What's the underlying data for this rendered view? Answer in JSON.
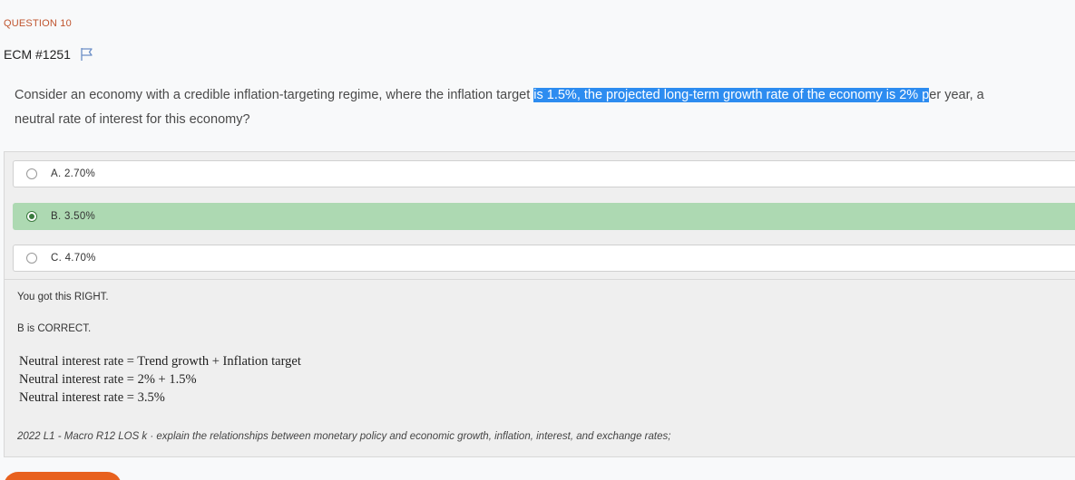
{
  "question": {
    "label": "QUESTION 10",
    "id": "ECM #1251",
    "stem_line1_pre": "Consider an economy with a credible inflation-targeting regime, where the inflation target ",
    "stem_line1_highlight": "is 1.5%, the projected long-term growth rate of the economy is 2% p",
    "stem_line1_post": "er year, a",
    "stem_line2": "neutral rate of interest for this economy?"
  },
  "options": [
    {
      "text": "A.  2.70%",
      "selected": false
    },
    {
      "text": "B.  3.50%",
      "selected": true
    },
    {
      "text": "C.  4.70%",
      "selected": false
    }
  ],
  "feedback": {
    "result": "You got this RIGHT.",
    "correct": "B is CORRECT.",
    "formula": [
      "Neutral interest rate = Trend growth + Inflation target",
      "Neutral interest rate = 2% + 1.5%",
      "Neutral interest rate = 3.5%"
    ],
    "los": "2022 L1 - Macro R12 LOS k · explain the relationships between monetary policy and economic growth, inflation, interest, and exchange rates;"
  },
  "colors": {
    "accent": "#e8611e",
    "highlight": "#2d8cf0",
    "selected": "#add9b2"
  },
  "icons": {
    "flag": "flag-icon",
    "radio": "radio-button"
  }
}
